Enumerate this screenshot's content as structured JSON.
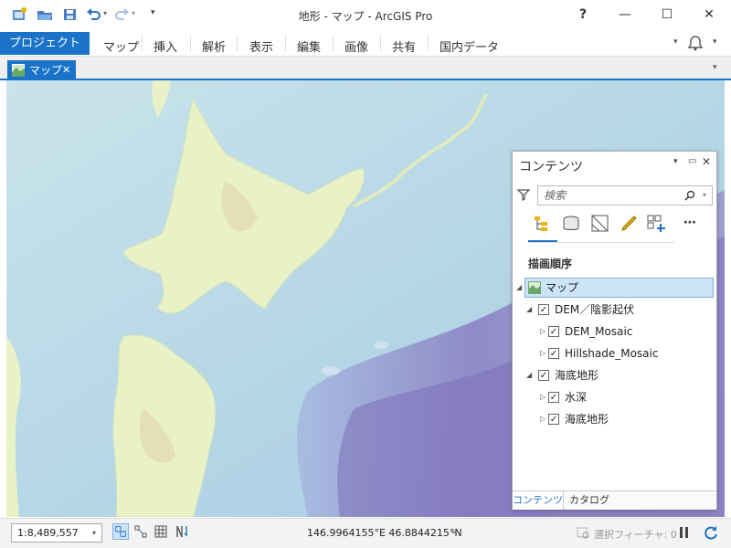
{
  "window": {
    "title": "地形 - マップ - ArcGIS Pro",
    "help": "?",
    "minimize": "—",
    "maximize": "☐",
    "close": "✕"
  },
  "ribbon": {
    "project": "プロジェクト",
    "tabs": [
      "マップ",
      "挿入",
      "解析",
      "表示",
      "編集",
      "画像",
      "共有",
      "国内データ"
    ]
  },
  "view_tab": {
    "label": "マップ",
    "close": "✕"
  },
  "status": {
    "scale": "1:8,489,557",
    "coords": "146.9964155°E 46.8844215°N",
    "selected_features": "選択フィーチャ: 0"
  },
  "contents": {
    "title": "コンテンツ",
    "search_placeholder": "検索",
    "section": "描画順序",
    "tree": [
      {
        "label": "マップ",
        "level": 0
      },
      {
        "label": "DEM／陰影起伏",
        "level": 1,
        "checked": true
      },
      {
        "label": "DEM_Mosaic",
        "level": 2,
        "checked": true
      },
      {
        "label": "Hillshade_Mosaic",
        "level": 2,
        "checked": true
      },
      {
        "label": "海底地形",
        "level": 1,
        "checked": true
      },
      {
        "label": "水深",
        "level": 2,
        "checked": true
      },
      {
        "label": "海底地形",
        "level": 2,
        "checked": true
      }
    ],
    "bottom_tabs": [
      "コンテンツ",
      "カタログ"
    ]
  },
  "colors": {
    "accent": "#1a73c8",
    "land": "#e9f1c6",
    "sea": "#bcdde7",
    "deep": "#8a7fc2"
  },
  "icons": [
    "new-project-icon",
    "open-icon",
    "save-icon",
    "undo-icon",
    "redo-icon",
    "filter-icon",
    "search-icon",
    "drawing-order-icon",
    "data-source-icon",
    "selection-icon",
    "editing-icon",
    "add-layer-icon",
    "more-icon",
    "bell-icon",
    "refresh-icon",
    "pause-icon"
  ]
}
